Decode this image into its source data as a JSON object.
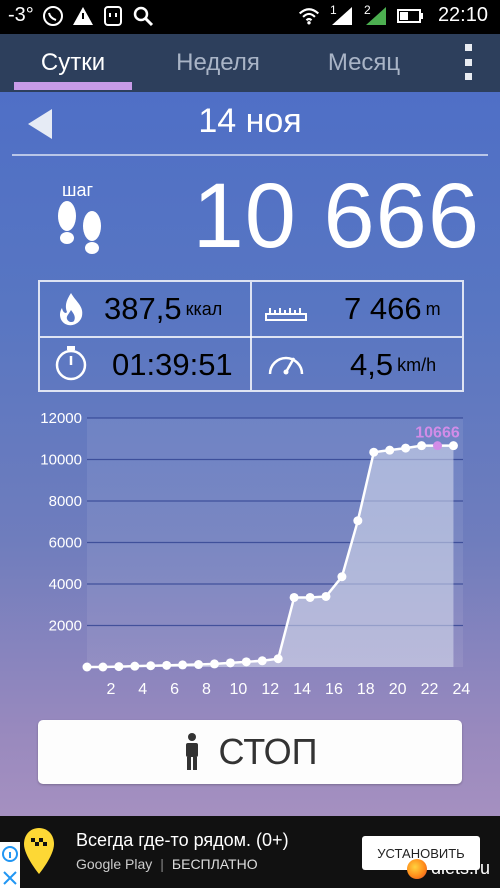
{
  "status_bar": {
    "temperature": "-3°",
    "time": "22:10",
    "sim1": "1",
    "sim2": "2",
    "icons": [
      "viber-icon",
      "warning-icon",
      "device-icon",
      "search-icon",
      "wifi-icon",
      "signal-icon",
      "battery-icon"
    ]
  },
  "tabs": {
    "day": "Сутки",
    "week": "Неделя",
    "month": "Месяц",
    "active": "day"
  },
  "header": {
    "date": "14 ноя"
  },
  "steps": {
    "label": "шаг",
    "value": "10 666"
  },
  "stats": {
    "calories": {
      "value": "387,5",
      "unit": "ккал"
    },
    "distance": {
      "value": "7 466",
      "unit": "m"
    },
    "duration": {
      "value": "01:39:51"
    },
    "speed": {
      "value": "4,5",
      "unit": "km/h"
    }
  },
  "chart_data": {
    "type": "area",
    "title": "",
    "xlabel": "",
    "ylabel": "",
    "ylim": [
      0,
      12000
    ],
    "xlim": [
      0,
      23
    ],
    "x_ticks": [
      2,
      4,
      6,
      8,
      10,
      12,
      14,
      16,
      18,
      20,
      22,
      24
    ],
    "y_ticks": [
      2000,
      4000,
      6000,
      8000,
      10000,
      12000
    ],
    "grid": true,
    "x": [
      0,
      1,
      2,
      3,
      4,
      5,
      6,
      7,
      8,
      9,
      10,
      11,
      12,
      13,
      14,
      15,
      16,
      17,
      18,
      19,
      20,
      21,
      22,
      23
    ],
    "values": [
      0,
      0,
      20,
      40,
      60,
      80,
      100,
      120,
      150,
      200,
      250,
      300,
      400,
      3350,
      3350,
      3400,
      4350,
      7050,
      10350,
      10450,
      10550,
      10666,
      10666,
      10666
    ],
    "highlight": {
      "x": 22,
      "label": "10666"
    },
    "colors": {
      "line": "#ffffff",
      "fill": "#d8deef",
      "highlight": "#d28ce8",
      "grid": "#2c3e8e"
    }
  },
  "stop_button": {
    "label": "СТОП"
  },
  "ad": {
    "title": "Всегда где-то рядом. (0+)",
    "store": "Google Play",
    "price": "БЕСПЛАТНО",
    "install": "УСТАНОВИТЬ",
    "watermark": "diets.ru"
  },
  "colors": {
    "appbar": "#2d3f5c",
    "tab_indicator": "#c89be8",
    "background_top": "#4f6fc6",
    "background_bottom": "#a590c0"
  }
}
